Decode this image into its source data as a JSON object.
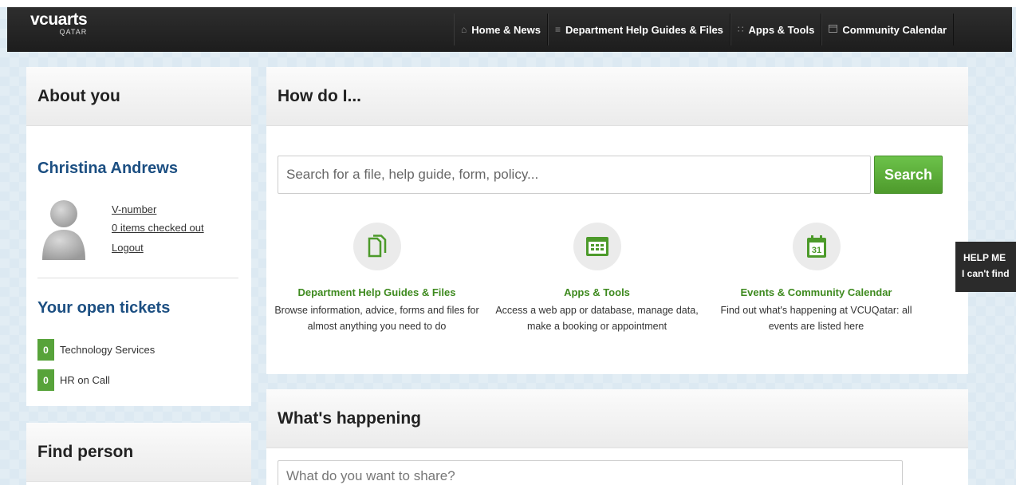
{
  "nav": {
    "logo_main": "vcuarts",
    "logo_sub": "QATAR",
    "links": [
      {
        "label": "Home & News",
        "icon": "home-icon"
      },
      {
        "label": "Department Help Guides & Files",
        "icon": "list-icon"
      },
      {
        "label": "Apps & Tools",
        "icon": "grid-icon"
      },
      {
        "label": "Community Calendar",
        "icon": "calendar-icon"
      }
    ]
  },
  "about": {
    "title": "About you",
    "user_name": "Christina Andrews",
    "links": [
      "V-number",
      "0 items checked out",
      "Logout"
    ],
    "tickets_title": "Your open tickets",
    "tickets": [
      {
        "count": "0",
        "label": "Technology Services"
      },
      {
        "count": "0",
        "label": "HR on Call"
      }
    ]
  },
  "find_person": {
    "title": "Find person"
  },
  "howdo": {
    "title": "How do I...",
    "search_placeholder": "Search for a file, help guide, form, policy...",
    "search_button": "Search",
    "features": [
      {
        "title": "Department Help Guides & Files",
        "desc": "Browse information, advice, forms and files for almost anything you need to do",
        "icon": "files-icon"
      },
      {
        "title": "Apps & Tools",
        "desc": "Access a web app or database, manage data, make a booking or appointment",
        "icon": "apps-window-icon"
      },
      {
        "title": "Events & Community Calendar",
        "desc": "Find out what's happening at VCUQatar: all events are listed here",
        "icon": "calendar-31-icon",
        "day": "31"
      }
    ]
  },
  "happening": {
    "title": "What's happening",
    "share_placeholder": "What do you want to share?"
  },
  "help_tab": {
    "line1": "HELP ME",
    "line2": "I can't find"
  },
  "colors": {
    "accent_green": "#57a33a",
    "link_blue": "#1c4f82",
    "nav_dark": "#232323"
  }
}
